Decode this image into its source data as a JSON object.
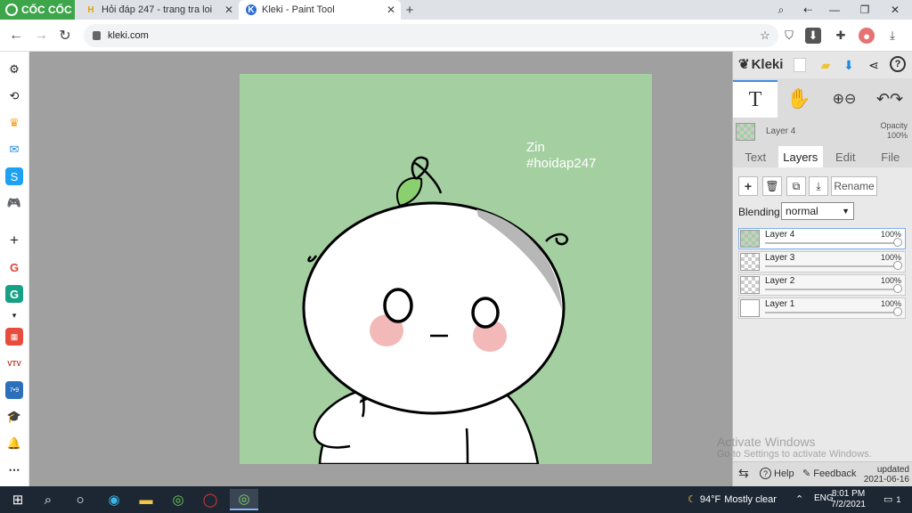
{
  "browser": {
    "brand": "CỐC CỐC",
    "tabs": [
      {
        "title": "Hỏi đáp 247 - trang tra loi",
        "favicon": "H",
        "active": false
      },
      {
        "title": "Kleki - Paint Tool",
        "favicon": "K",
        "active": true
      }
    ],
    "url": "kleki.com"
  },
  "canvas_text": {
    "line1": "Zin",
    "line2": "#hoidap247"
  },
  "kleki": {
    "logo": "Kleki",
    "current_layer": {
      "name": "Layer 4",
      "opacity_label": "Opacity",
      "opacity": "100%"
    },
    "panel_tabs": [
      "Text",
      "Layers",
      "Edit",
      "File"
    ],
    "active_tab": "Layers",
    "rename_label": "Rename",
    "blending_label": "Blending",
    "blending_value": "normal",
    "layers": [
      {
        "name": "Layer 4",
        "opacity": "100%",
        "selected": true
      },
      {
        "name": "Layer 3",
        "opacity": "100%",
        "selected": false
      },
      {
        "name": "Layer 2",
        "opacity": "100%",
        "selected": false
      },
      {
        "name": "Layer 1",
        "opacity": "100%",
        "selected": false
      }
    ],
    "bottom": {
      "help": "Help",
      "feedback": "Feedback",
      "updated_label": "updated",
      "updated_date": "2021-06-16"
    }
  },
  "windows_watermark": {
    "line1": "Activate Windows",
    "line2": "Go to Settings to activate Windows."
  },
  "taskbar": {
    "weather_temp": "94°F",
    "weather_text": "Mostly clear",
    "language": "ENG",
    "time": "8:01 PM",
    "date": "7/2/2021",
    "notifications": "1"
  },
  "colors": {
    "canvas_bg": "#a4cfa0",
    "brand": "#3da54a",
    "accent": "#3d8de5"
  }
}
